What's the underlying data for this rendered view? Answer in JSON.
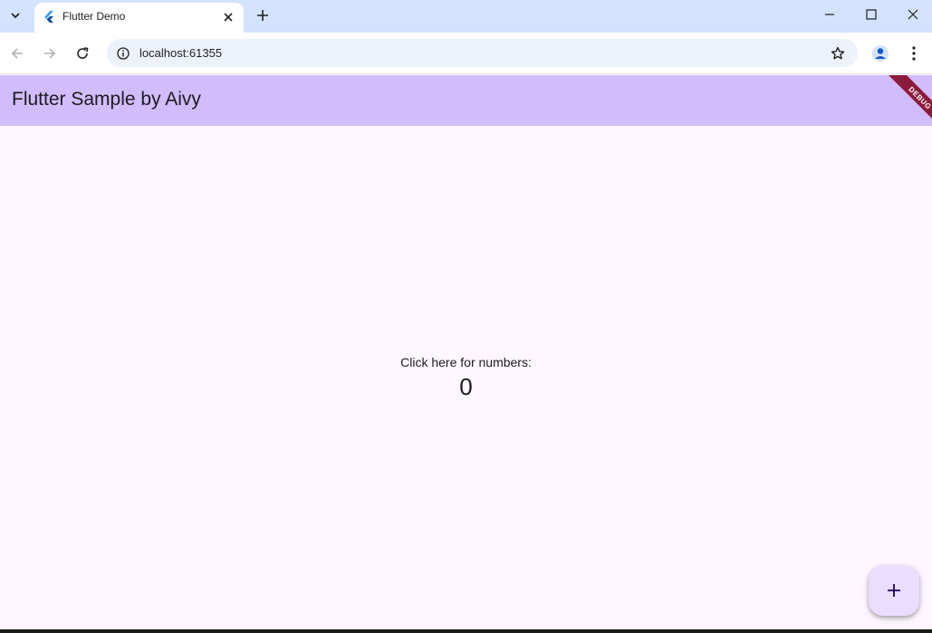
{
  "browser": {
    "tab_title": "Flutter Demo",
    "url": "localhost:61355"
  },
  "app": {
    "title": "Flutter Sample by Aivy",
    "debug_label": "DEBUG",
    "prompt": "Click here for numbers:",
    "counter": "0",
    "primary_color": "#d1bcfc",
    "background_color": "#fef7ff",
    "fab_color": "#eaddff",
    "fab_icon": "add-icon"
  },
  "icons": {
    "tab_search": "chevron-down-icon",
    "favicon": "flutter-icon",
    "tab_close": "close-icon",
    "new_tab": "plus-icon",
    "back": "back-arrow-icon",
    "forward": "forward-arrow-icon",
    "reload": "reload-icon",
    "site_info": "info-icon",
    "bookmark": "star-icon",
    "profile": "profile-icon",
    "menu": "more-vert-icon"
  }
}
